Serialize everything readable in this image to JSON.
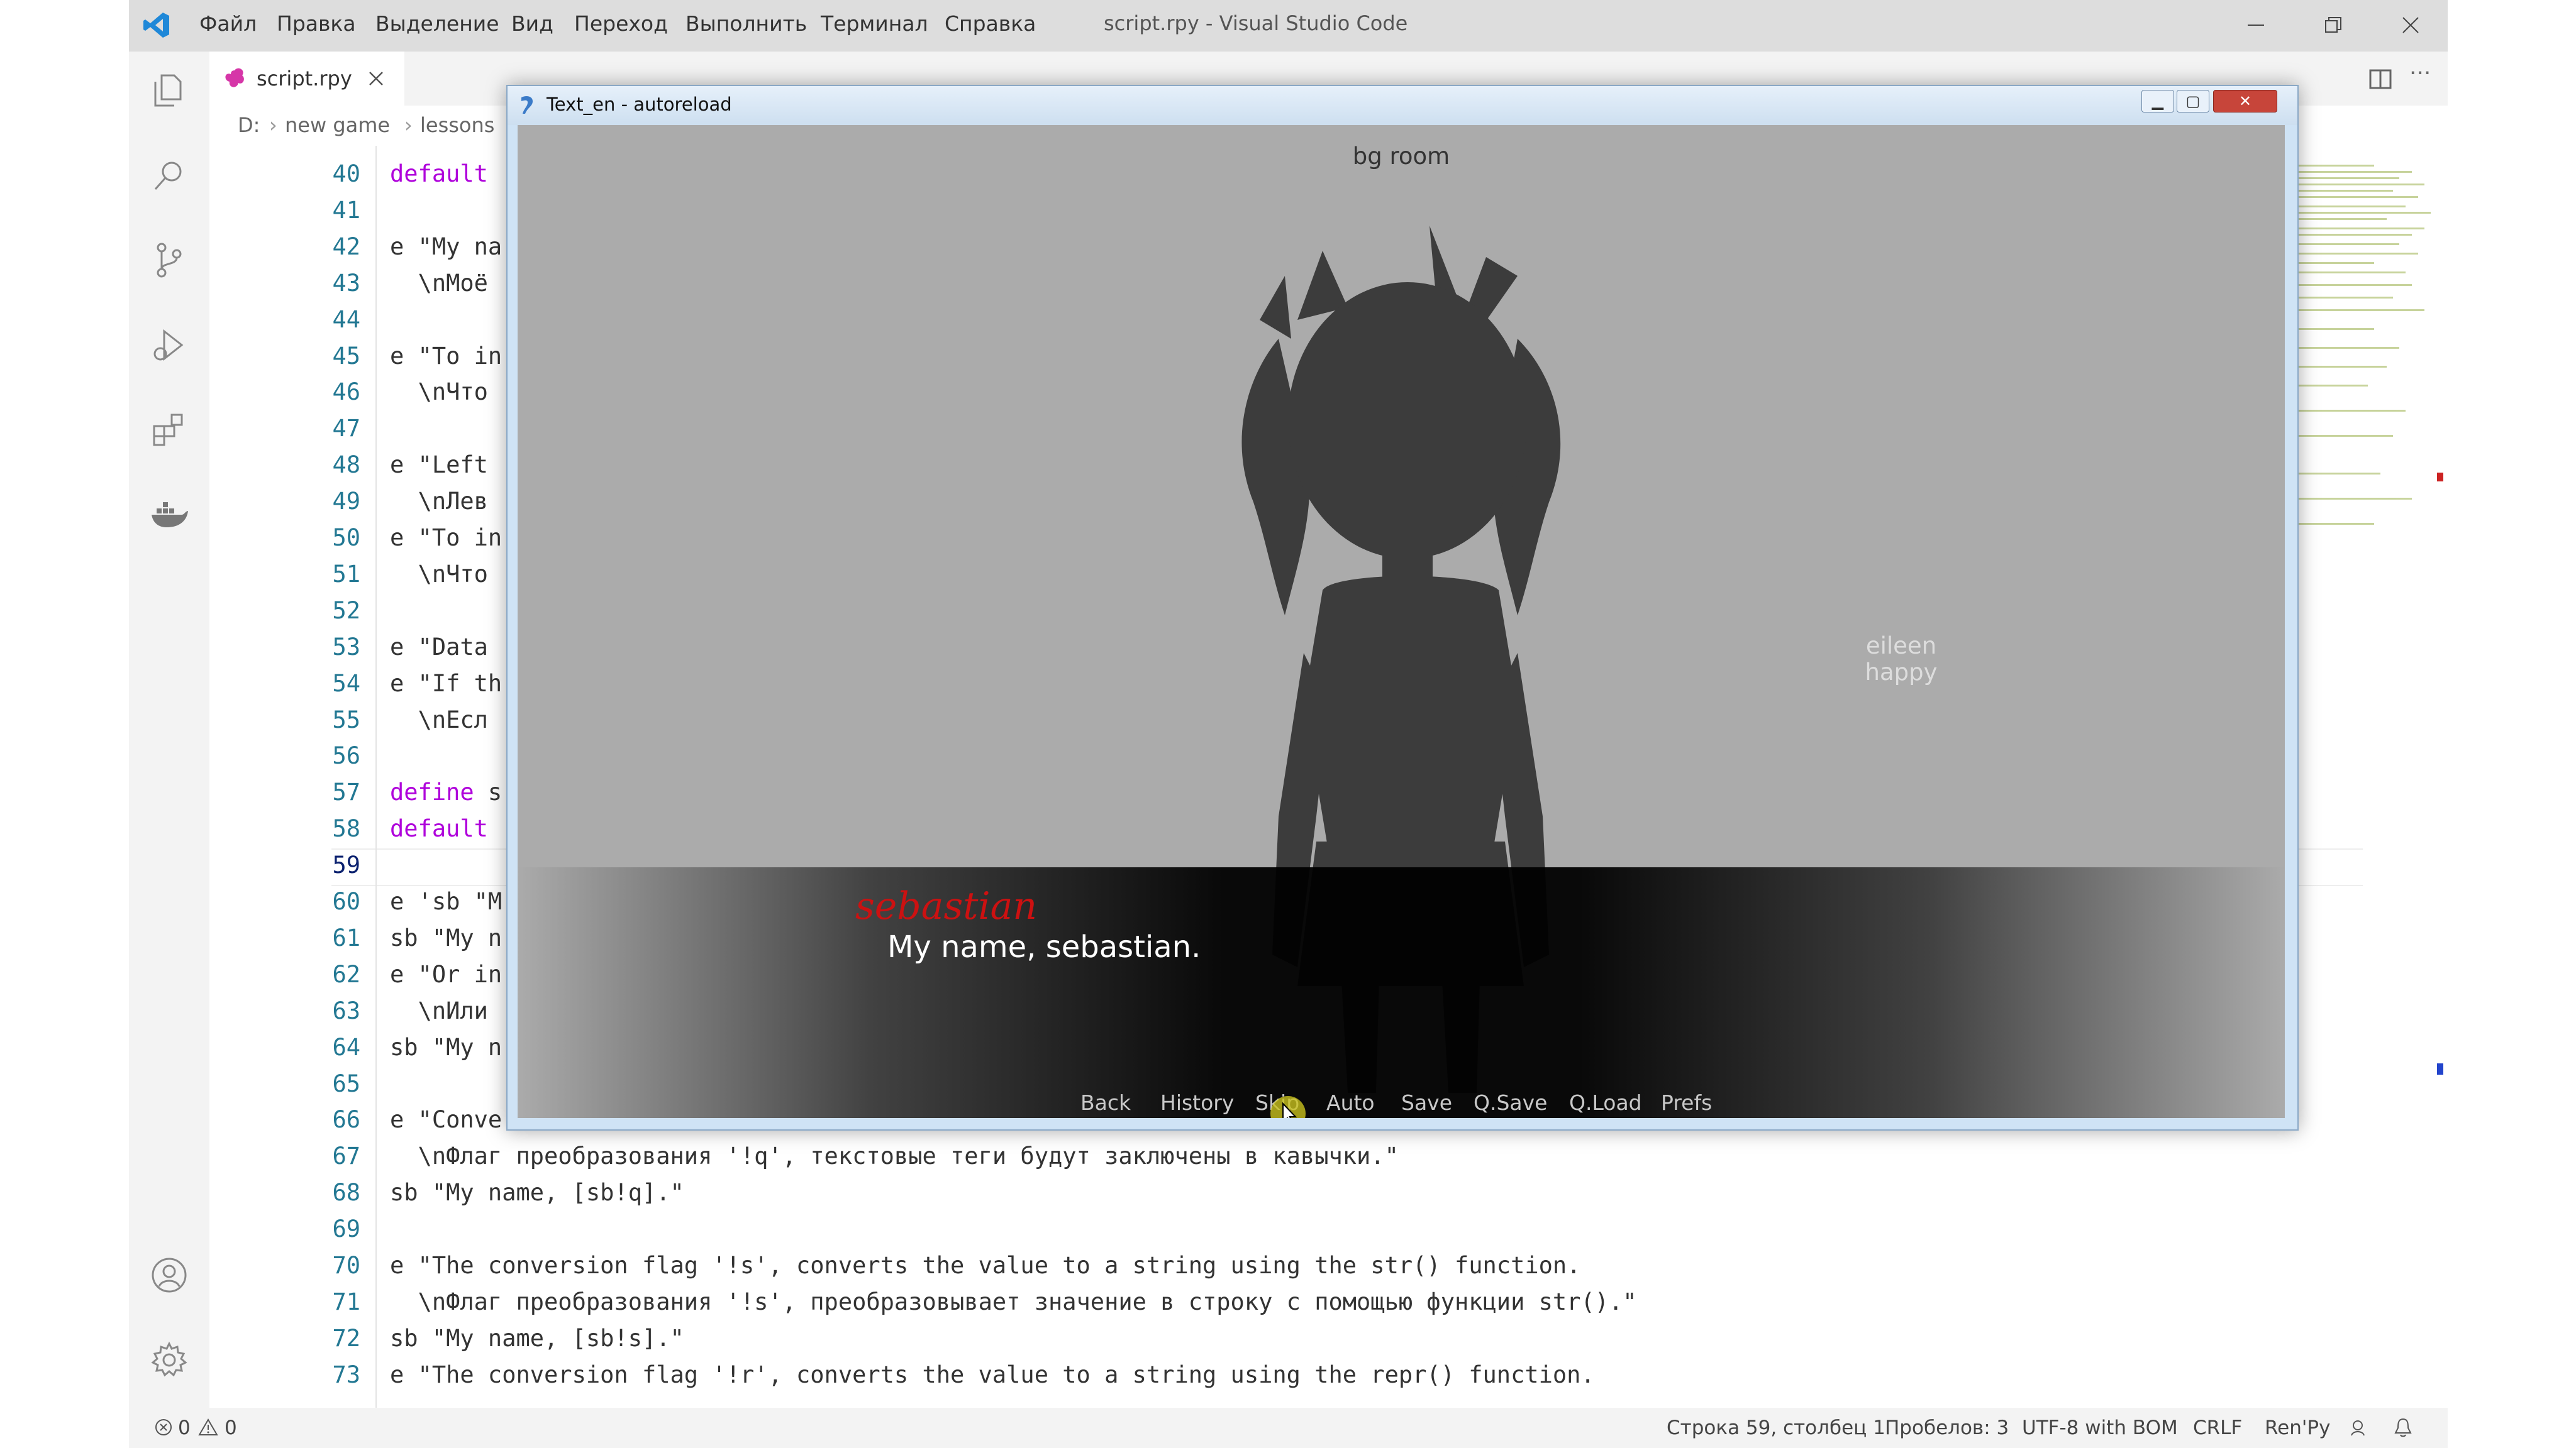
{
  "vscode": {
    "menu": [
      "Файл",
      "Правка",
      "Выделение",
      "Вид",
      "Переход",
      "Выполнить",
      "Терминал",
      "Справка"
    ],
    "window_title": "script.rpy - Visual Studio Code",
    "tab_label": "script.rpy",
    "breadcrumb": [
      "D:",
      "new game",
      "lessons"
    ],
    "lines": [
      {
        "n": "40",
        "text": "default "
      },
      {
        "n": "41",
        "text": ""
      },
      {
        "n": "42",
        "text": "e \"My na"
      },
      {
        "n": "43",
        "text": "  \\nМоё"
      },
      {
        "n": "44",
        "text": ""
      },
      {
        "n": "45",
        "text": "e \"To in"
      },
      {
        "n": "46",
        "text": "  \\nЧто"
      },
      {
        "n": "47",
        "text": ""
      },
      {
        "n": "48",
        "text": "e \"Left "
      },
      {
        "n": "49",
        "text": "  \\nЛев"
      },
      {
        "n": "50",
        "text": "e \"To in"
      },
      {
        "n": "51",
        "text": "  \\nЧто"
      },
      {
        "n": "52",
        "text": ""
      },
      {
        "n": "53",
        "text": "e \"Data "
      },
      {
        "n": "54",
        "text": "e \"If th"
      },
      {
        "n": "55",
        "text": "  \\nЕсл"
      },
      {
        "n": "56",
        "text": ""
      },
      {
        "n": "57",
        "text": "define s"
      },
      {
        "n": "58",
        "text": "default "
      },
      {
        "n": "59",
        "text": ""
      },
      {
        "n": "60",
        "text": "e 'sb \"M"
      },
      {
        "n": "61",
        "text": "sb \"My n"
      },
      {
        "n": "62",
        "text": "e \"Or in"
      },
      {
        "n": "63",
        "text": "  \\nИли"
      },
      {
        "n": "64",
        "text": "sb \"My n"
      },
      {
        "n": "65",
        "text": ""
      },
      {
        "n": "66",
        "text": "e \"Conve"
      },
      {
        "n": "67",
        "text": "  \\nФлаг преобразования '!q', текстовые теги будут заключены в кавычки.\""
      },
      {
        "n": "68",
        "text": "sb \"My name, [sb!q].\""
      },
      {
        "n": "69",
        "text": ""
      },
      {
        "n": "70",
        "text": "e \"The conversion flag '!s', converts the value to a string using the str() function."
      },
      {
        "n": "71",
        "text": "  \\nФлаг преобразования '!s', преобразовывает значение в строку с помощью функции str().\""
      },
      {
        "n": "72",
        "text": "sb \"My name, [sb!s].\""
      },
      {
        "n": "73",
        "text": "e \"The conversion flag '!r', converts the value to a string using the repr() function."
      }
    ],
    "status": {
      "errors": "0",
      "warnings": "0",
      "position": "Строка 59, столбец 1",
      "spaces": "Пробелов: 3",
      "encoding": "UTF-8 with BOM",
      "eol": "CRLF",
      "language": "Ren'Py"
    }
  },
  "renpy": {
    "window_title": "Text_en - autoreload",
    "scene_label": "bg room",
    "character_label_1": "eileen",
    "character_label_2": "happy",
    "speaker": "sebastian",
    "dialogue": "My name, sebastian.",
    "quick_menu": [
      "Back",
      "History",
      "Skip",
      "Auto",
      "Save",
      "Q.Save",
      "Q.Load",
      "Prefs"
    ]
  },
  "colors": {
    "speaker": "#cc1111",
    "keyword": "#af00db",
    "line_number": "#237893"
  },
  "icons": [
    "vscode-logo-icon",
    "explorer-icon",
    "search-icon",
    "source-control-icon",
    "run-debug-icon",
    "extensions-icon",
    "docker-icon",
    "account-icon",
    "settings-gear-icon",
    "renpy-file-icon",
    "close-icon",
    "split-editor-icon",
    "more-icon",
    "error-icon",
    "warning-icon",
    "notifications-icon"
  ]
}
